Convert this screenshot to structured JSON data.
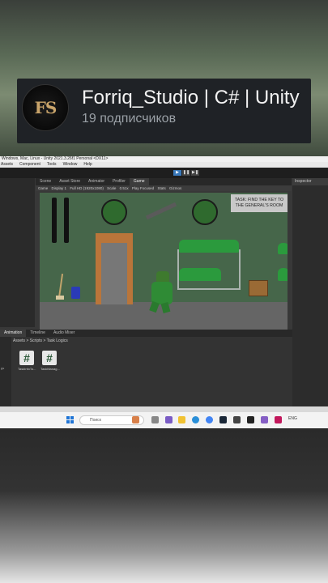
{
  "channel": {
    "avatar_text": "FS",
    "name": "Forriq_Studio | C# | Unity",
    "subscribers": "19 подписчиков"
  },
  "unity": {
    "title": "Windows, Mac, Linux - Unity 2021.3.26f1 Personal <DX11>",
    "menu": [
      "Assets",
      "Component",
      "Tools",
      "Window",
      "Help"
    ],
    "play_buttons": [
      "▶",
      "❚❚",
      "▶❚"
    ],
    "tabs": [
      "Scene",
      "Asset Store",
      "Animator",
      "Profiler",
      "Game"
    ],
    "active_tab": "Game",
    "game_bar": {
      "mode": "Game",
      "display": "Display 1",
      "resolution": "Full HD (1920x1080)",
      "scale_label": "Scale",
      "scale_value": "0.51x",
      "play_focused": "Play Focused",
      "stats": "Stats",
      "gizmos": "Gizmos"
    },
    "task_text": "TASK: FIND THE KEY TO THE GENERAL'S ROOM",
    "inspector_tab": "Inspector",
    "bottom_tabs": [
      "Animation",
      "Timeline",
      "Audio Mixer"
    ],
    "breadcrumb": "Assets > Scripts > Task Logics",
    "assets": [
      {
        "icon": "#",
        "label": "TaskInfoTo..."
      },
      {
        "icon": "#",
        "label": "TaskManag..."
      }
    ],
    "sidebar_label": "gs"
  },
  "taskbar": {
    "search_placeholder": "Поиск",
    "tray_label": "ENG"
  },
  "colors": {
    "accent_blue": "#3a79bb",
    "game_bg": "#46664a",
    "unity_dark": "#383838"
  }
}
